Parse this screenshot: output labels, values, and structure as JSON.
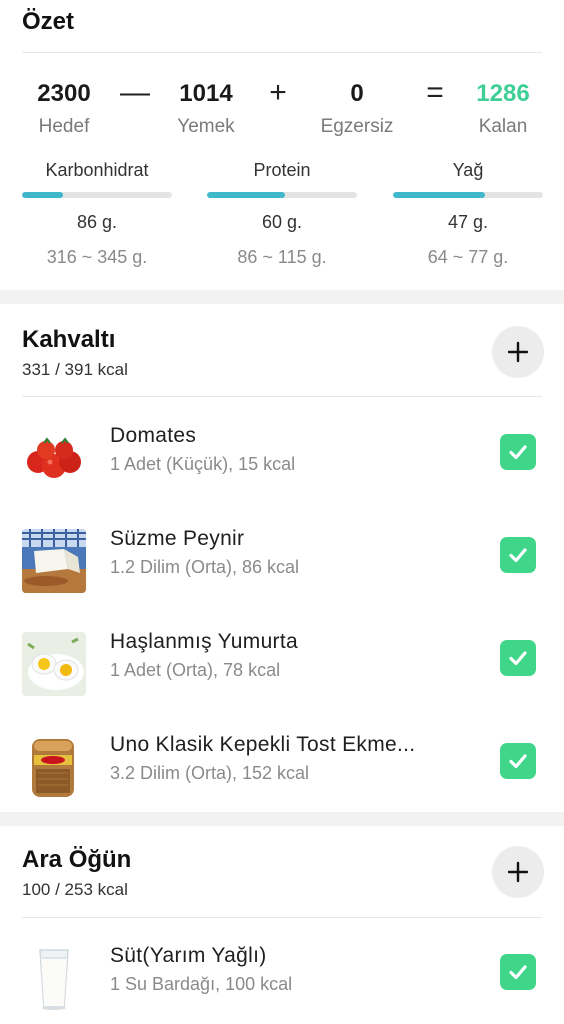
{
  "summary": {
    "title": "Özet",
    "target": {
      "value": "2300",
      "label": "Hedef"
    },
    "food": {
      "value": "1014",
      "label": "Yemek"
    },
    "exercise": {
      "value": "0",
      "label": "Egzersiz"
    },
    "remaining": {
      "value": "1286",
      "label": "Kalan"
    },
    "operators": {
      "minus": "—",
      "plus": "+",
      "equals": "="
    },
    "colors": {
      "remaining": "#3fcf96",
      "macro_bar": "#3fb8cc",
      "check": "#3fd68a"
    },
    "macros": [
      {
        "label": "Karbonhidrat",
        "value": "86 g.",
        "range": "316 ~ 345 g.",
        "fill": 0.27
      },
      {
        "label": "Protein",
        "value": "60 g.",
        "range": "86 ~ 115 g.",
        "fill": 0.52
      },
      {
        "label": "Yağ",
        "value": "47 g.",
        "range": "64 ~ 77 g.",
        "fill": 0.61
      }
    ]
  },
  "meals": [
    {
      "title": "Kahvaltı",
      "kcal": "331 / 391 kcal",
      "items": [
        {
          "name": "Domates",
          "detail": "1 Adet (Küçük), 15 kcal",
          "image": "tomato-image",
          "checked": true
        },
        {
          "name": "Süzme Peynir",
          "detail": "1.2 Dilim (Orta), 86 kcal",
          "image": "cheese-image",
          "checked": true
        },
        {
          "name": "Haşlanmış Yumurta",
          "detail": "1 Adet (Orta), 78 kcal",
          "image": "egg-image",
          "checked": true
        },
        {
          "name": "Uno Klasik Kepekli Tost Ekme...",
          "detail": "3.2 Dilim (Orta), 152 kcal",
          "image": "bread-image",
          "checked": true
        }
      ]
    },
    {
      "title": "Ara Öğün",
      "kcal": "100 / 253 kcal",
      "items": [
        {
          "name": "Süt(Yarım Yağlı)",
          "detail": "1 Su Bardağı, 100 kcal",
          "image": "milk-image",
          "checked": true
        }
      ]
    }
  ],
  "icons": {
    "add": "plus-icon",
    "check": "checkmark-icon"
  }
}
